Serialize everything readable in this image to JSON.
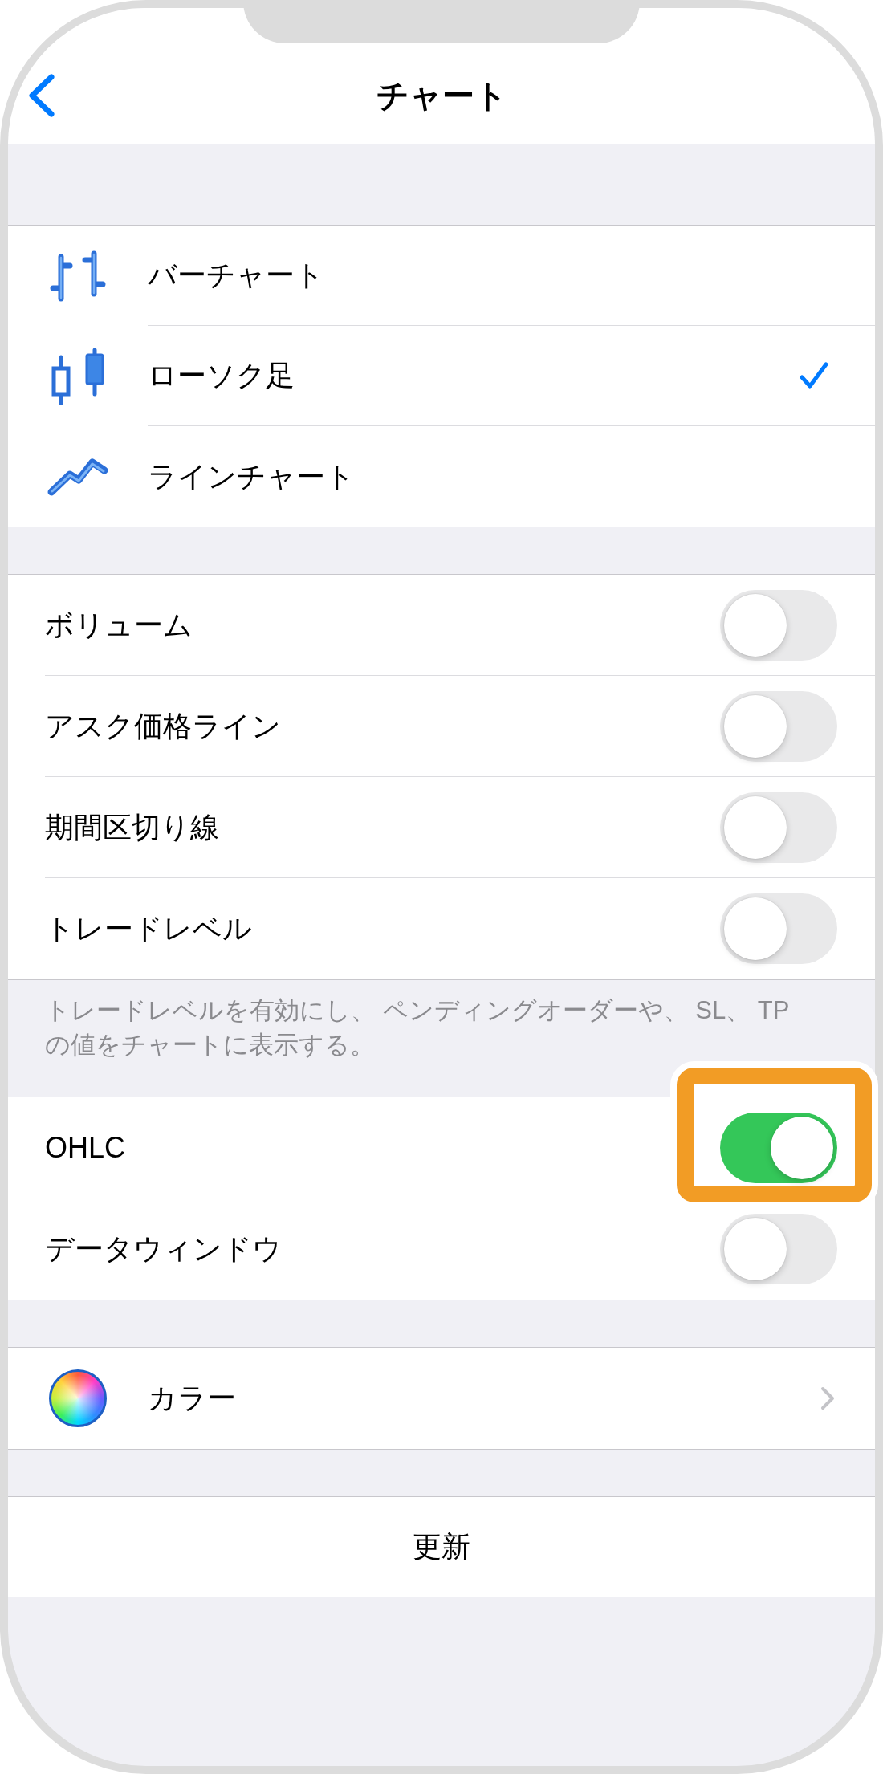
{
  "nav": {
    "title": "チャート"
  },
  "chart_types": [
    {
      "kind": "bar",
      "label": "バーチャート",
      "selected": false
    },
    {
      "kind": "candlestick",
      "label": "ローソク足",
      "selected": true
    },
    {
      "kind": "line",
      "label": "ラインチャート",
      "selected": false
    }
  ],
  "display_options": {
    "items": [
      {
        "label": "ボリューム",
        "on": false
      },
      {
        "label": "アスク価格ライン",
        "on": false
      },
      {
        "label": "期間区切り線",
        "on": false
      },
      {
        "label": "トレードレベル",
        "on": false
      }
    ],
    "footer": "トレードレベルを有効にし、 ペンディングオーダーや、 SL、 TPの値をチャートに表示する。"
  },
  "data_options": {
    "items": [
      {
        "label": "OHLC",
        "on": true,
        "highlighted": true
      },
      {
        "label": "データウィンドウ",
        "on": false,
        "highlighted": false
      }
    ]
  },
  "color_settings": {
    "label": "カラー"
  },
  "update_button": {
    "label": "更新"
  }
}
